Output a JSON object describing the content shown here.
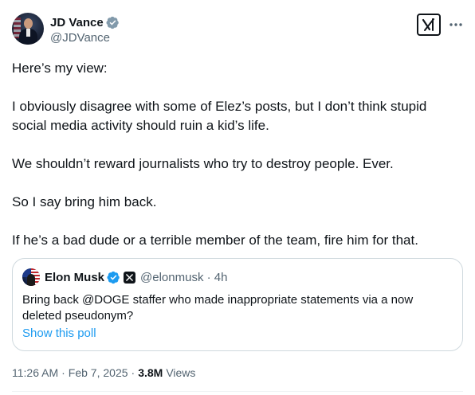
{
  "author": {
    "display_name": "JD Vance",
    "handle": "@JDVance",
    "verified_color": "#829aab"
  },
  "header": {
    "grok_icon": "grok-icon",
    "more_icon": "more-horizontal-icon"
  },
  "post": {
    "paragraphs": [
      "Here’s my view:",
      "I obviously disagree with some of Elez’s posts, but I don’t think stupid social media activity should ruin a kid’s life.",
      "We shouldn’t reward journalists who try to destroy people. Ever.",
      "So I say bring him back.",
      "If he’s a bad dude or a terrible member of the team, fire him for that."
    ]
  },
  "quote": {
    "display_name": "Elon Musk",
    "handle_time": "@elonmusk · 4h",
    "verified_color": "#1d9bf0",
    "text": "Bring back @DOGE staffer who made inappropriate statements via a now deleted pseudonym?",
    "link": "Show this poll"
  },
  "meta": {
    "time": "11:26 AM",
    "separator": "·",
    "date": "Feb 7, 2025",
    "views_count": "3.8M",
    "views_label": "Views"
  },
  "colors": {
    "text_primary": "#0f1419",
    "text_secondary": "#536471",
    "link": "#1d9bf0",
    "border": "#cfd9de"
  }
}
